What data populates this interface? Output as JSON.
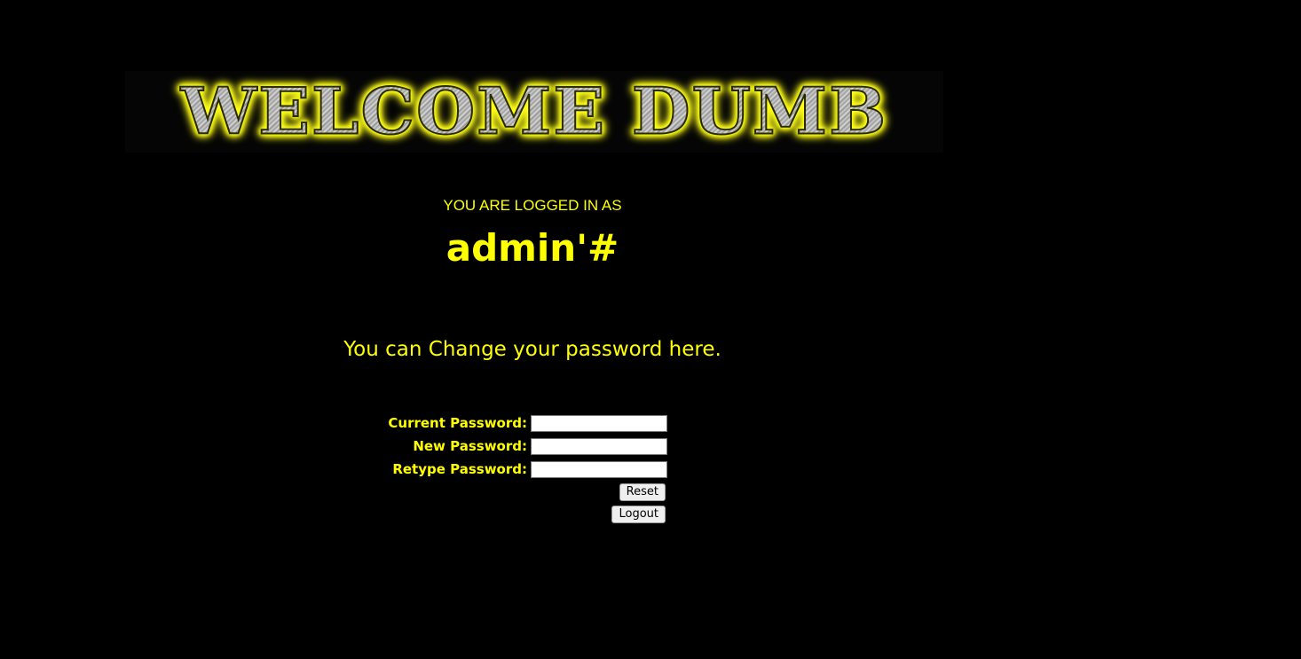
{
  "banner": {
    "text": "WELCOME DUMB"
  },
  "session": {
    "logged_in_label": "YOU ARE LOGGED IN AS",
    "username": "admin'#"
  },
  "main": {
    "change_text": "You can Change your password here."
  },
  "form": {
    "current_password_label": "Current Password:",
    "current_password_value": "",
    "new_password_label": "New Password:",
    "new_password_value": "",
    "retype_password_label": "Retype Password:",
    "retype_password_value": "",
    "reset_label": "Reset",
    "logout_label": "Logout"
  },
  "colors": {
    "background": "#000000",
    "text_accent": "#ffff00",
    "input_background": "#ffffff",
    "button_background": "#efefef"
  }
}
